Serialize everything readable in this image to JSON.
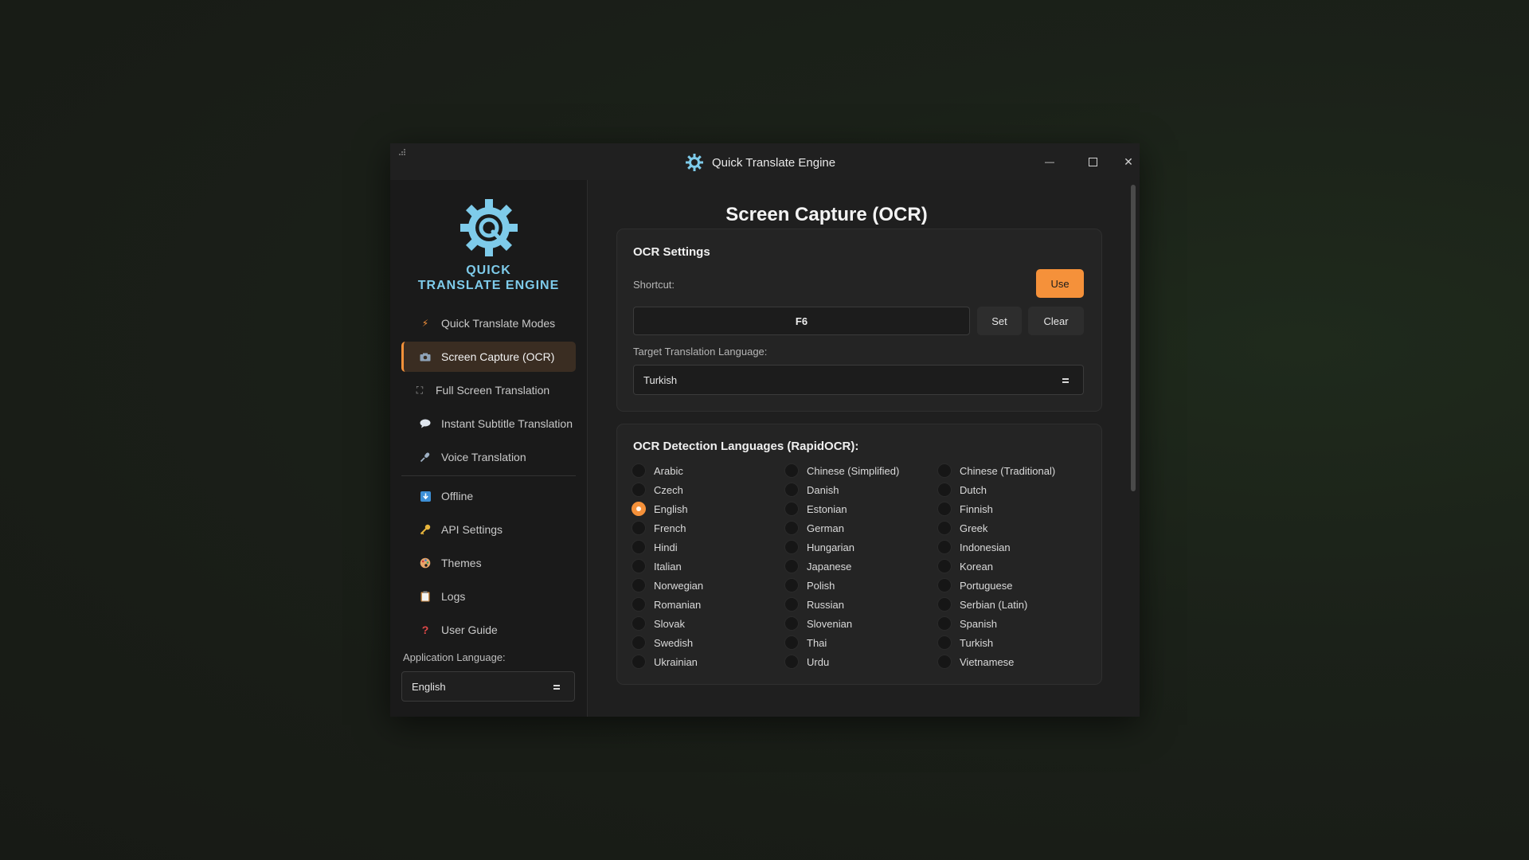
{
  "window": {
    "title": "Quick Translate Engine",
    "minimize_label": "—",
    "close_label": "✕"
  },
  "sidebar": {
    "logo_text_line1": "QUICK",
    "logo_text_line2": "TRANSLATE ENGINE",
    "nav": [
      {
        "label": "Quick Translate Modes",
        "icon": "lightning-icon"
      },
      {
        "label": "Screen Capture (OCR)",
        "icon": "camera-icon",
        "active": true
      },
      {
        "label": "Full Screen Translation",
        "icon": "fullscreen-icon"
      },
      {
        "label": "Instant Subtitle Translation",
        "icon": "speech-bubble-icon"
      },
      {
        "label": "Voice Translation",
        "icon": "microphone-icon"
      },
      {
        "label": "Offline",
        "icon": "download-icon"
      },
      {
        "label": "API Settings",
        "icon": "key-icon"
      },
      {
        "label": "Themes",
        "icon": "palette-icon"
      },
      {
        "label": "Logs",
        "icon": "clipboard-icon"
      },
      {
        "label": "User Guide",
        "icon": "question-icon"
      }
    ],
    "app_language_label": "Application Language:",
    "app_language_value": "English"
  },
  "main": {
    "page_title": "Screen Capture (OCR)",
    "ocr_settings": {
      "title": "OCR Settings",
      "shortcut_label": "Shortcut:",
      "use_button": "Use",
      "shortcut_value": "F6",
      "set_button": "Set",
      "clear_button": "Clear",
      "target_language_label": "Target Translation Language:",
      "target_language_value": "Turkish"
    },
    "detection": {
      "title": "OCR Detection Languages (RapidOCR):",
      "languages": [
        {
          "label": "Arabic",
          "checked": false
        },
        {
          "label": "Chinese (Simplified)",
          "checked": false
        },
        {
          "label": "Chinese (Traditional)",
          "checked": false
        },
        {
          "label": "Czech",
          "checked": false
        },
        {
          "label": "Danish",
          "checked": false
        },
        {
          "label": "Dutch",
          "checked": false
        },
        {
          "label": "English",
          "checked": true
        },
        {
          "label": "Estonian",
          "checked": false
        },
        {
          "label": "Finnish",
          "checked": false
        },
        {
          "label": "French",
          "checked": false
        },
        {
          "label": "German",
          "checked": false
        },
        {
          "label": "Greek",
          "checked": false
        },
        {
          "label": "Hindi",
          "checked": false
        },
        {
          "label": "Hungarian",
          "checked": false
        },
        {
          "label": "Indonesian",
          "checked": false
        },
        {
          "label": "Italian",
          "checked": false
        },
        {
          "label": "Japanese",
          "checked": false
        },
        {
          "label": "Korean",
          "checked": false
        },
        {
          "label": "Norwegian",
          "checked": false
        },
        {
          "label": "Polish",
          "checked": false
        },
        {
          "label": "Portuguese",
          "checked": false
        },
        {
          "label": "Romanian",
          "checked": false
        },
        {
          "label": "Russian",
          "checked": false
        },
        {
          "label": "Serbian (Latin)",
          "checked": false
        },
        {
          "label": "Slovak",
          "checked": false
        },
        {
          "label": "Slovenian",
          "checked": false
        },
        {
          "label": "Spanish",
          "checked": false
        },
        {
          "label": "Swedish",
          "checked": false
        },
        {
          "label": "Thai",
          "checked": false
        },
        {
          "label": "Turkish",
          "checked": false
        },
        {
          "label": "Ukrainian",
          "checked": false
        },
        {
          "label": "Urdu",
          "checked": false
        },
        {
          "label": "Vietnamese",
          "checked": false
        }
      ]
    }
  },
  "colors": {
    "accent": "#f5913a",
    "logo": "#7ecbea",
    "background": "#1f1f1f"
  }
}
